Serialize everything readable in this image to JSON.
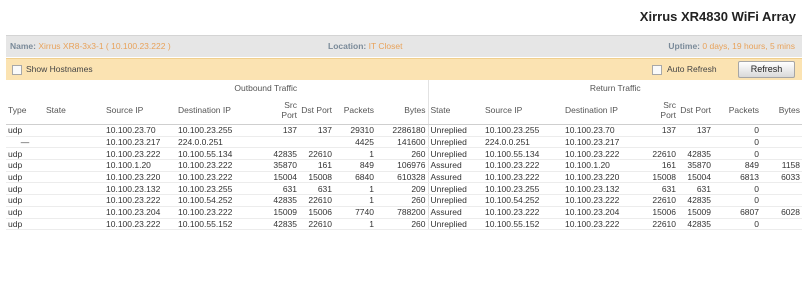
{
  "title": "Xirrus XR4830 WiFi Array",
  "info": {
    "name_label": "Name:",
    "name_value": "Xirrus XR8-3x3-1   ( 10.100.23.222 )",
    "location_label": "Location:",
    "location_value": "IT Closet",
    "uptime_label": "Uptime:",
    "uptime_value": "0 days, 19 hours, 5 mins"
  },
  "controls": {
    "show_hostnames": "Show Hostnames",
    "auto_refresh": "Auto Refresh",
    "refresh": "Refresh"
  },
  "table": {
    "outbound_label": "Outbound Traffic",
    "return_label": "Return Traffic",
    "columns": [
      "Type",
      "State",
      "Source IP",
      "Destination IP",
      "Src Port",
      "Dst Port",
      "Packets",
      "Bytes",
      "State",
      "Source IP",
      "Destination IP",
      "Src Port",
      "Dst Port",
      "Packets",
      "Bytes"
    ],
    "rows": [
      [
        "udp",
        "",
        "10.100.23.70",
        "10.100.23.255",
        "137",
        "137",
        "29310",
        "2286180",
        "Unreplied",
        "10.100.23.255",
        "10.100.23.70",
        "137",
        "137",
        "0",
        ""
      ],
      [
        "—",
        "",
        "10.100.23.217",
        "224.0.0.251",
        "",
        "",
        "4425",
        "141600",
        "Unreplied",
        "224.0.0.251",
        "10.100.23.217",
        "",
        "",
        "0",
        ""
      ],
      [
        "udp",
        "",
        "10.100.23.222",
        "10.100.55.134",
        "42835",
        "22610",
        "1",
        "260",
        "Unreplied",
        "10.100.55.134",
        "10.100.23.222",
        "22610",
        "42835",
        "0",
        ""
      ],
      [
        "udp",
        "",
        "10.100.1.20",
        "10.100.23.222",
        "35870",
        "161",
        "849",
        "106976",
        "Assured",
        "10.100.23.222",
        "10.100.1.20",
        "161",
        "35870",
        "849",
        "1158"
      ],
      [
        "udp",
        "",
        "10.100.23.220",
        "10.100.23.222",
        "15004",
        "15008",
        "6840",
        "610328",
        "Assured",
        "10.100.23.222",
        "10.100.23.220",
        "15008",
        "15004",
        "6813",
        "6033"
      ],
      [
        "udp",
        "",
        "10.100.23.132",
        "10.100.23.255",
        "631",
        "631",
        "1",
        "209",
        "Unreplied",
        "10.100.23.255",
        "10.100.23.132",
        "631",
        "631",
        "0",
        ""
      ],
      [
        "udp",
        "",
        "10.100.23.222",
        "10.100.54.252",
        "42835",
        "22610",
        "1",
        "260",
        "Unreplied",
        "10.100.54.252",
        "10.100.23.222",
        "22610",
        "42835",
        "0",
        ""
      ],
      [
        "udp",
        "",
        "10.100.23.204",
        "10.100.23.222",
        "15009",
        "15006",
        "7740",
        "788200",
        "Assured",
        "10.100.23.222",
        "10.100.23.204",
        "15006",
        "15009",
        "6807",
        "6028"
      ],
      [
        "udp",
        "",
        "10.100.23.222",
        "10.100.55.152",
        "42835",
        "22610",
        "1",
        "260",
        "Unreplied",
        "10.100.55.152",
        "10.100.23.222",
        "22610",
        "42835",
        "0",
        ""
      ]
    ]
  }
}
